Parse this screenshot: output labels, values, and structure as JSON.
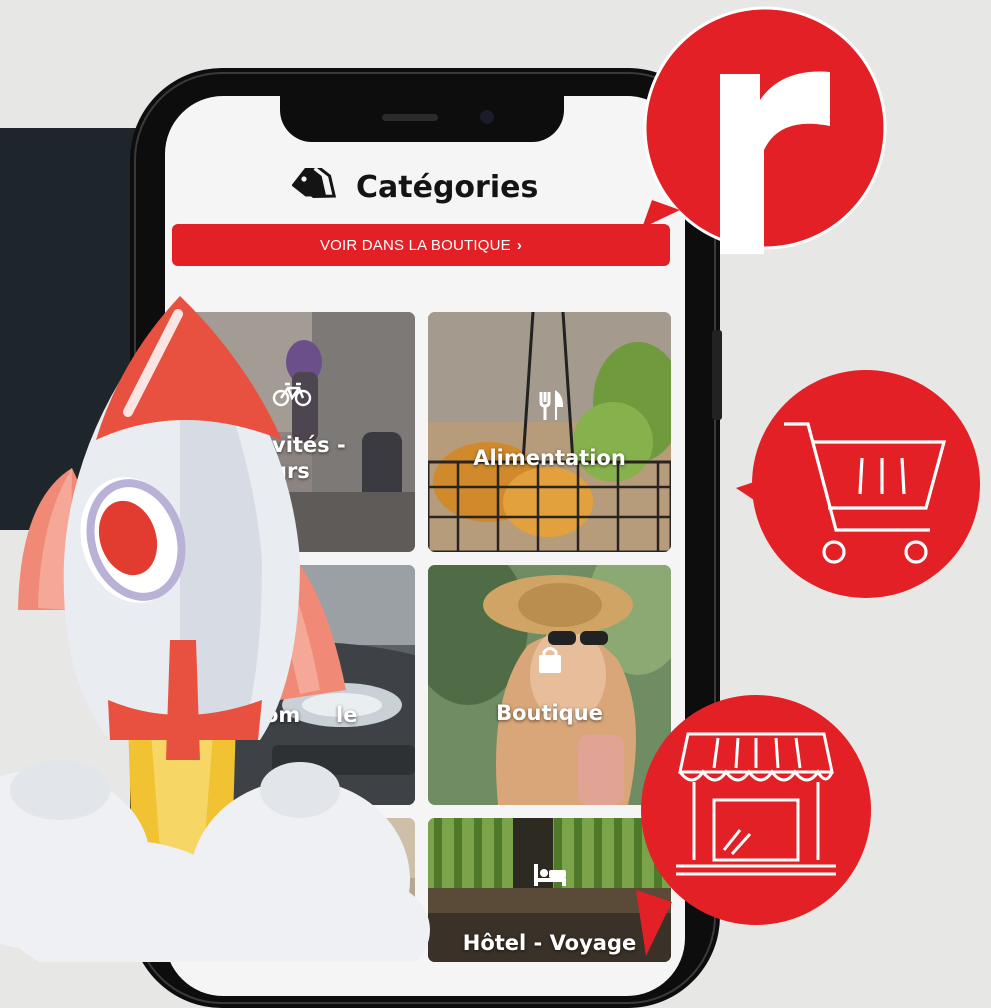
{
  "header": {
    "title": "Catégories",
    "title_icon": "tag-icon"
  },
  "boutique_button": {
    "label": "VOIR DANS LA BOUTIQUE",
    "chevron": "›"
  },
  "categories": [
    {
      "label": "Activités - Loisirs",
      "label_line1": "vités -",
      "label_line2": "urs",
      "icon": "bicycle-icon"
    },
    {
      "label": "Alimentation",
      "icon": "fork-knife-icon"
    },
    {
      "label": "Automobile",
      "visible_part_1": "om",
      "visible_part_2": "le",
      "icon": "car-icon"
    },
    {
      "label": "Boutique",
      "icon": "shopping-bag-icon"
    },
    {
      "label": "",
      "icon": ""
    },
    {
      "label": "Hôtel - Voyage",
      "icon": "bed-icon"
    }
  ],
  "badges": [
    {
      "name": "brand-logo",
      "letter": "r"
    },
    {
      "name": "cart-badge",
      "icon": "shopping-cart-icon"
    },
    {
      "name": "store-badge",
      "icon": "storefront-icon"
    }
  ],
  "colors": {
    "brand_red": "#e22026",
    "dark_panel": "#1f262b",
    "background": "#e7e7e5"
  }
}
